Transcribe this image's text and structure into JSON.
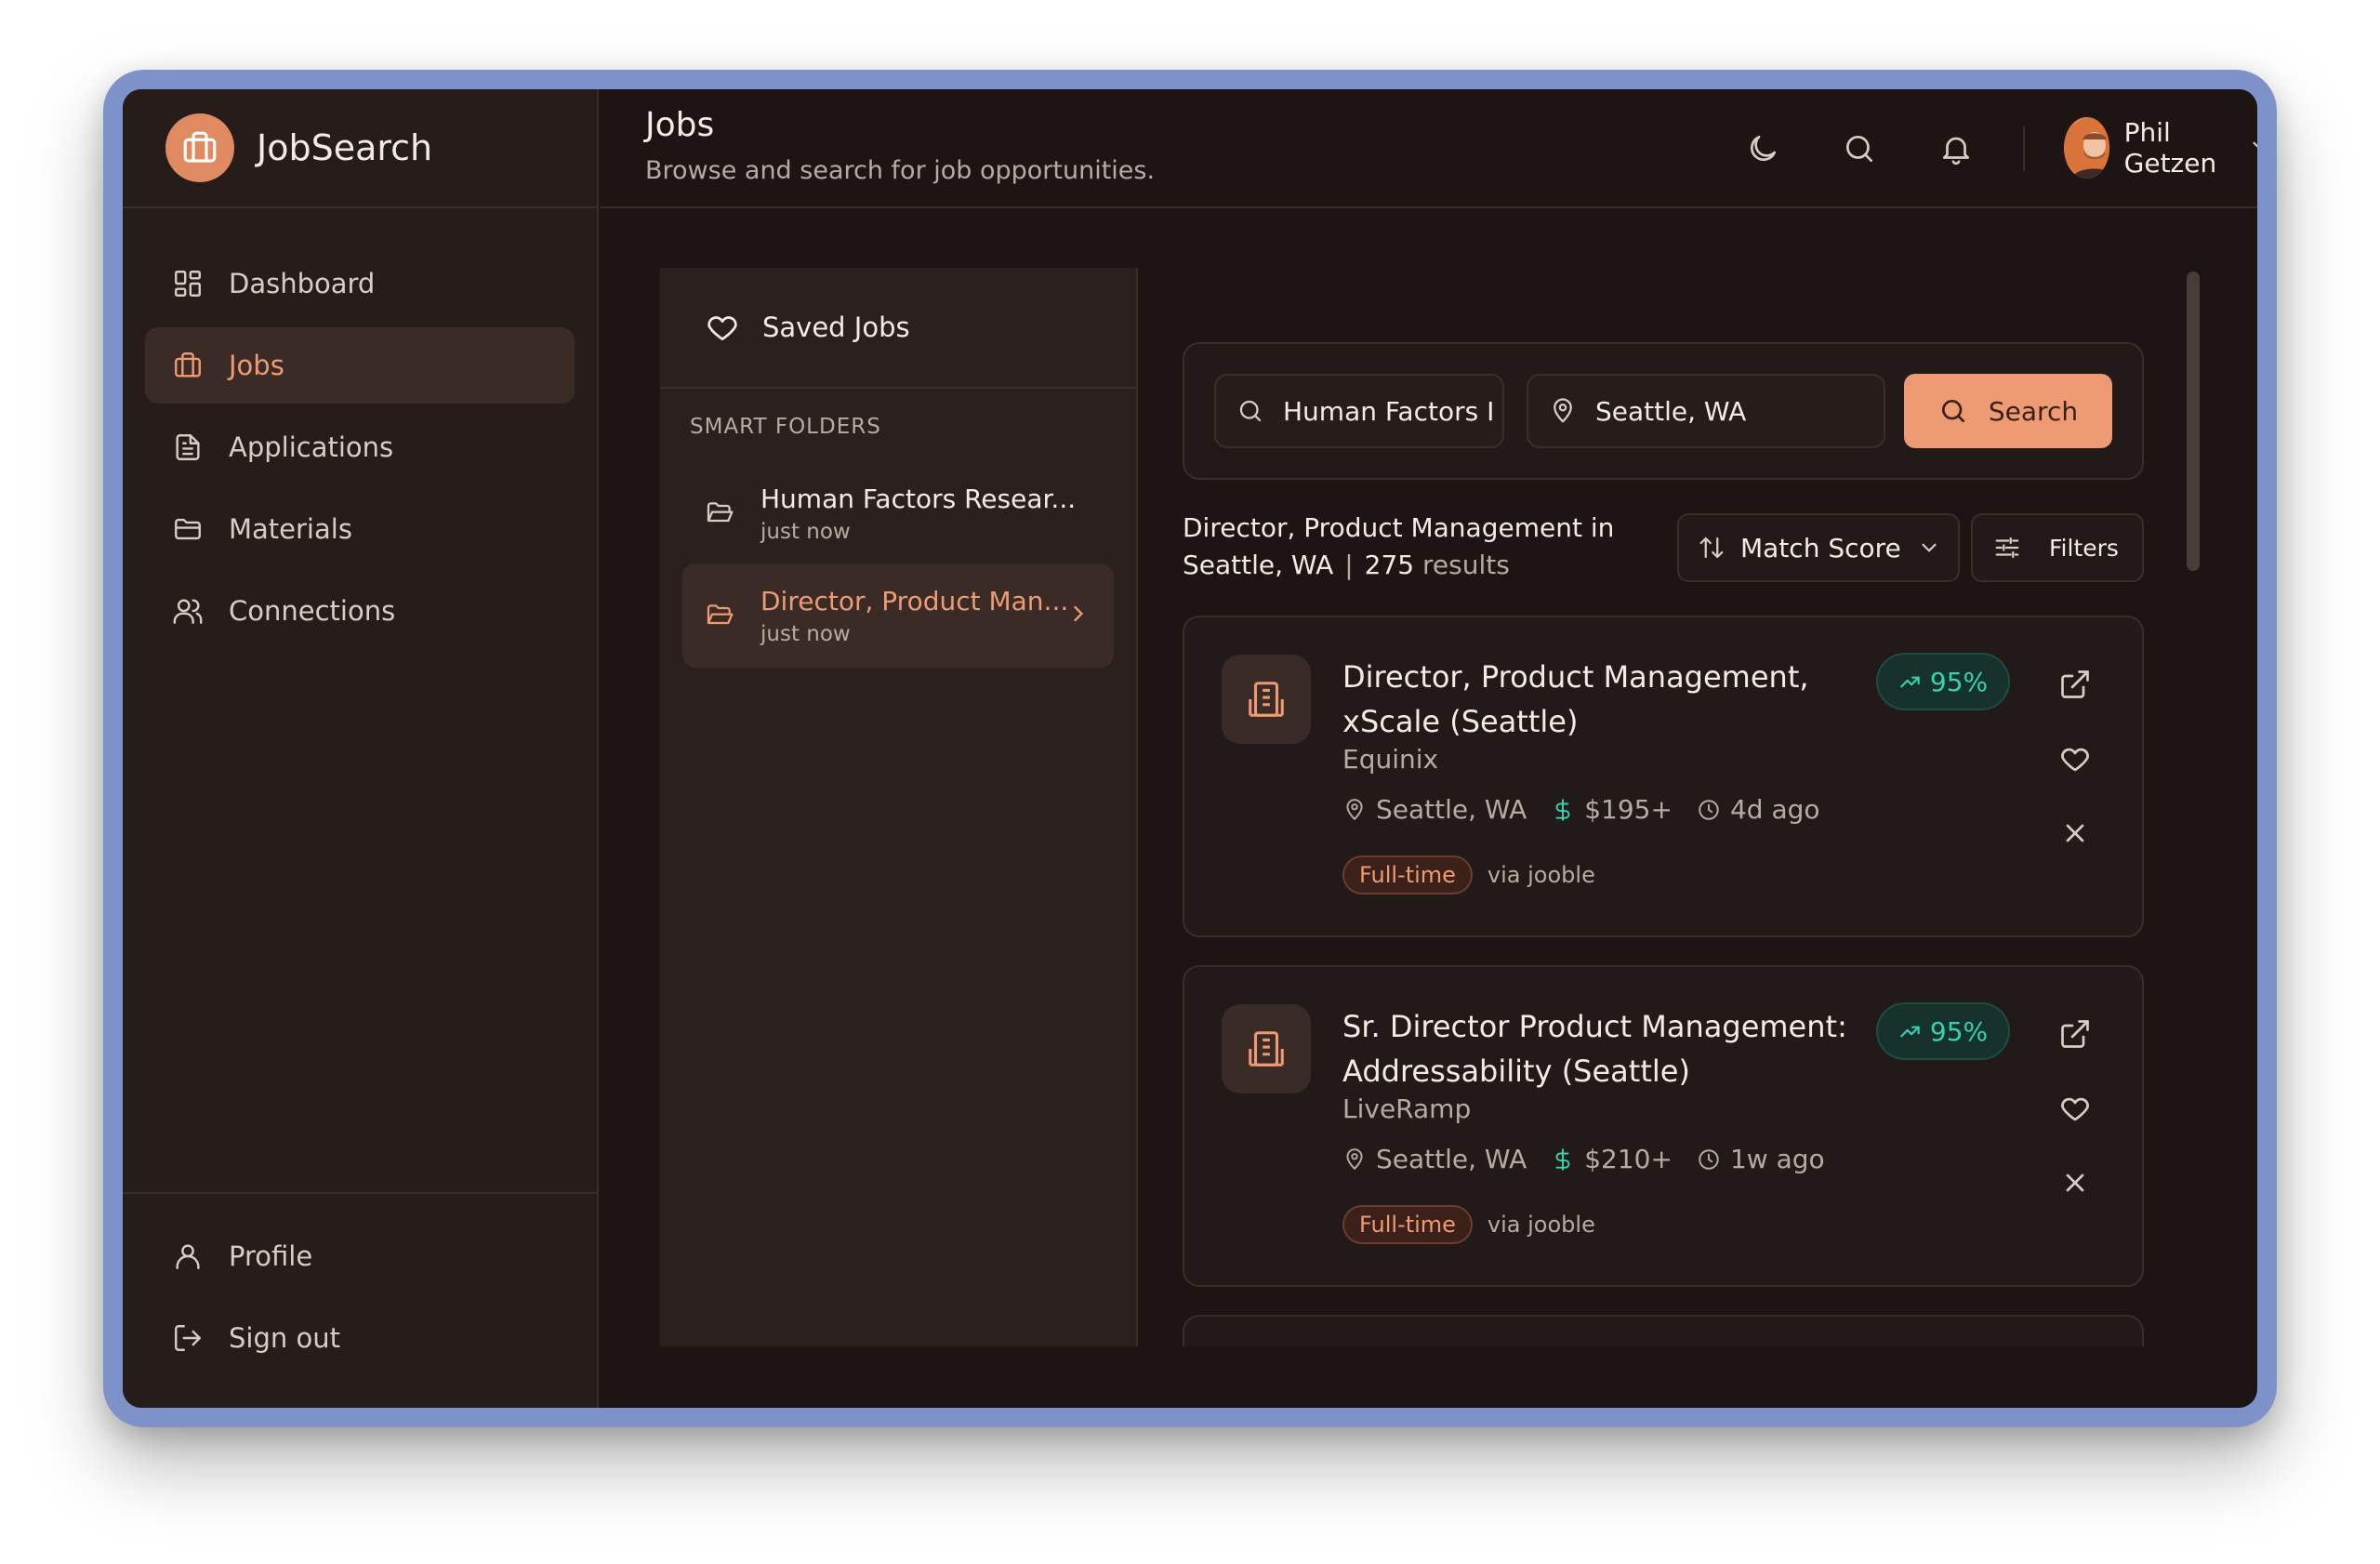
{
  "app": {
    "name": "JobSearch"
  },
  "sidebar": {
    "items": [
      {
        "label": "Dashboard",
        "icon": "dashboard-icon"
      },
      {
        "label": "Jobs",
        "icon": "briefcase-icon",
        "active": true
      },
      {
        "label": "Applications",
        "icon": "document-icon"
      },
      {
        "label": "Materials",
        "icon": "folder-icon"
      },
      {
        "label": "Connections",
        "icon": "users-icon"
      }
    ],
    "bottom": [
      {
        "label": "Profile",
        "icon": "user-icon"
      },
      {
        "label": "Sign out",
        "icon": "sign-out-icon"
      }
    ]
  },
  "header": {
    "title": "Jobs",
    "subtitle": "Browse and search for job opportunities.",
    "user_name": "Phil Getzen"
  },
  "folders": {
    "saved_label": "Saved Jobs",
    "smart_label": "SMART FOLDERS",
    "items": [
      {
        "title": "Human Factors Resear...",
        "time": "just now"
      },
      {
        "title": "Director, Product Man...",
        "time": "just now",
        "active": true
      }
    ]
  },
  "search": {
    "query": "Human Factors I",
    "location": "Seattle, WA",
    "button": "Search"
  },
  "results": {
    "line1": "Director, Product Management in",
    "line2": "Seattle, WA",
    "count": "275",
    "count_label": "results",
    "sort_label": "Match Score",
    "filters_label": "Filters"
  },
  "jobs": [
    {
      "title": "Director, Product Management, xScale (Seattle)",
      "company": "Equinix",
      "location": "Seattle, WA",
      "salary": "$195+",
      "posted": "4d ago",
      "type": "Full-time",
      "source": "via jooble",
      "match": "95%"
    },
    {
      "title": "Sr. Director Product Management: Addressability (Seattle)",
      "company": "LiveRamp",
      "location": "Seattle, WA",
      "salary": "$210+",
      "posted": "1w ago",
      "type": "Full-time",
      "source": "via jooble",
      "match": "95%"
    }
  ],
  "colors": {
    "accent": "#ee9a72",
    "match": "#34d3b0",
    "background": "#1d1514",
    "panel": "#261d1b",
    "frame": "#7d92c8"
  }
}
